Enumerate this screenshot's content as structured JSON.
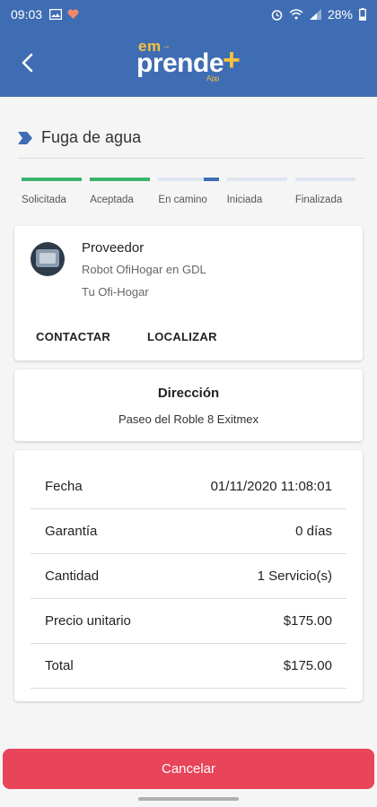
{
  "status_bar": {
    "time": "09:03",
    "battery": "28%"
  },
  "app_bar": {
    "logo_top": "em",
    "logo_main": "prende",
    "logo_plus": "+",
    "logo_sub": "App"
  },
  "service": {
    "title": "Fuga de agua"
  },
  "steps": [
    {
      "label": "Solicitada",
      "progress": 1.0
    },
    {
      "label": "Aceptada",
      "progress": 1.0
    },
    {
      "label": "En camino",
      "progress": 0.25
    },
    {
      "label": "Iniciada",
      "progress": 0
    },
    {
      "label": "Finalizada",
      "progress": 0
    }
  ],
  "provider": {
    "heading": "Proveedor",
    "name": "Robot OfiHogar en GDL",
    "business": "Tu Ofi-Hogar",
    "contact_label": "CONTACTAR",
    "locate_label": "LOCALIZAR"
  },
  "address": {
    "heading": "Dirección",
    "value": "Paseo del Roble 8 Exitmex"
  },
  "details": [
    {
      "label": "Fecha",
      "value": "01/11/2020 11:08:01"
    },
    {
      "label": "Garantía",
      "value": "0 días"
    },
    {
      "label": "Cantidad",
      "value": "1 Servicio(s)"
    },
    {
      "label": "Precio unitario",
      "value": "$175.00"
    },
    {
      "label": "Total",
      "value": "$175.00"
    }
  ],
  "cancel_label": "Cancelar",
  "colors": {
    "brand": "#3f6db3",
    "step_done": "#3bb36a",
    "step_active": "#3f6db3",
    "cancel": "#e8445a"
  }
}
